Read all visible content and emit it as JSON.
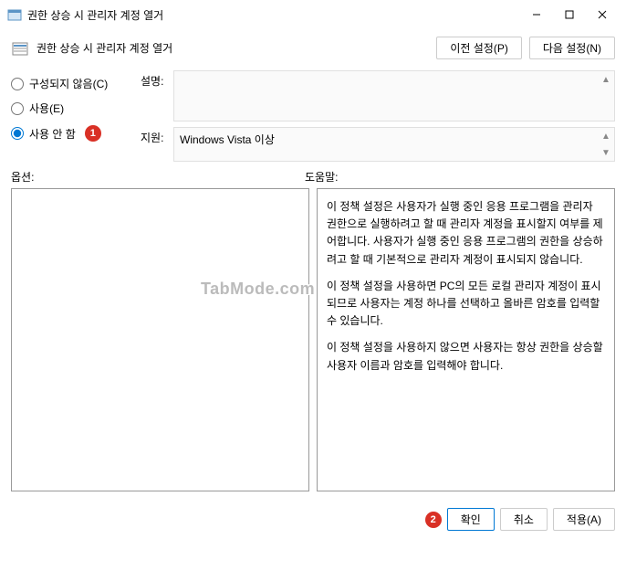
{
  "window": {
    "title": "권한 상승 시 관리자 계정 열거"
  },
  "header": {
    "title": "권한 상승 시 관리자 계정 열거",
    "prev_button": "이전 설정(P)",
    "next_button": "다음 설정(N)"
  },
  "radios": {
    "not_configured": "구성되지 않음(C)",
    "enabled": "사용(E)",
    "disabled": "사용 안 함"
  },
  "fields": {
    "desc_label": "설명:",
    "desc_value": "",
    "support_label": "지원:",
    "support_value": "Windows Vista 이상"
  },
  "section_labels": {
    "options": "옵션:",
    "help": "도움말:"
  },
  "help_paragraphs": {
    "p1": "이 정책 설정은 사용자가 실행 중인 응용 프로그램을 관리자 권한으로 실행하려고 할 때 관리자 계정을 표시할지 여부를 제어합니다. 사용자가 실행 중인 응용 프로그램의 권한을 상승하려고 할 때 기본적으로 관리자 계정이 표시되지 않습니다.",
    "p2": "이 정책 설정을 사용하면 PC의 모든 로컬 관리자 계정이 표시되므로 사용자는 계정 하나를 선택하고 올바른 암호를 입력할 수 있습니다.",
    "p3": "이 정책 설정을 사용하지 않으면 사용자는 항상 권한을 상승할 사용자 이름과 암호를 입력해야 합니다."
  },
  "buttons": {
    "ok": "확인",
    "cancel": "취소",
    "apply": "적용(A)"
  },
  "badges": {
    "b1": "1",
    "b2": "2"
  },
  "watermark": "TabMode.com"
}
